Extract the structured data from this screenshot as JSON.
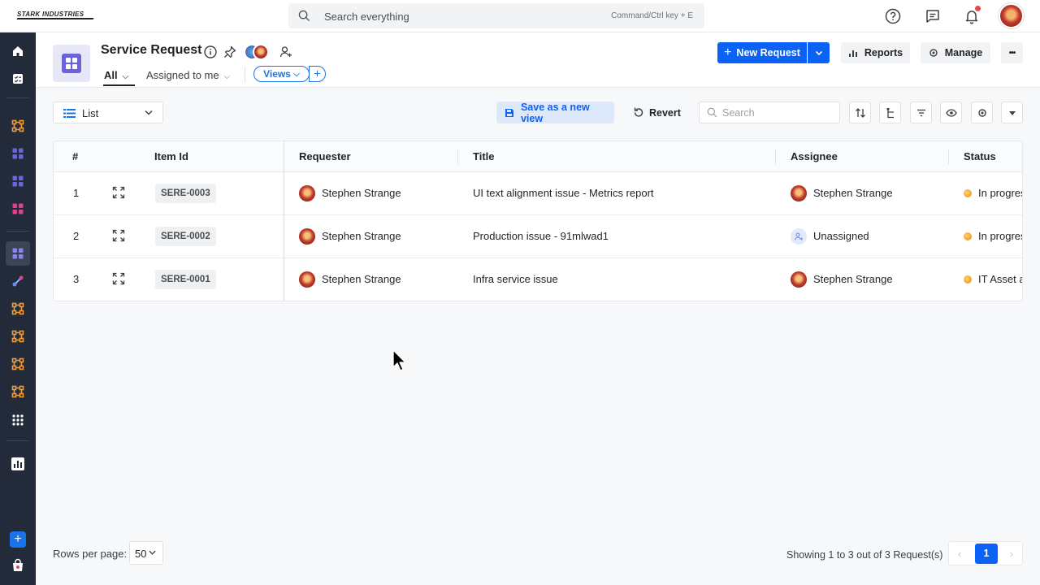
{
  "topbar": {
    "logo_text": "STARK INDUSTRIES",
    "search_placeholder": "Search everything",
    "search_shortcut": "Command/Ctrl key + E",
    "icons": [
      "help-icon",
      "feedback-icon",
      "bell-icon",
      "user-avatar"
    ]
  },
  "sidebar": {
    "items": [
      "home-icon",
      "tasks-icon",
      "workflow-icon",
      "apps-icon",
      "apps-icon",
      "apps-icon",
      "service-request-icon",
      "integration-icon",
      "workflow-icon",
      "workflow-icon",
      "workflow-icon",
      "workflow-icon",
      "all-apps-icon",
      "reports-icon"
    ],
    "add_label": "+"
  },
  "header": {
    "title": "Service Request",
    "tabs": [
      {
        "label": "All",
        "active": true
      },
      {
        "label": "Assigned to me",
        "active": false
      }
    ],
    "views_label": "Views",
    "views_add": "+",
    "new_request_label": "New Request",
    "reports_label": "Reports",
    "manage_label": "Manage",
    "more_label": "•••"
  },
  "toolbar": {
    "view_select": "List",
    "save_view_label": "Save as a new view",
    "revert_label": "Revert",
    "search_placeholder": "Search"
  },
  "table": {
    "columns": [
      "#",
      "Item Id",
      "Requester",
      "Title",
      "Assignee",
      "Status"
    ],
    "rows": [
      {
        "num": "1",
        "item_id": "SERE-0003",
        "requester": "Stephen Strange",
        "title": "UI text alignment issue - Metrics report",
        "assignee": "Stephen Strange",
        "assignee_unassigned": false,
        "status": "In progres"
      },
      {
        "num": "2",
        "item_id": "SERE-0002",
        "requester": "Stephen Strange",
        "title": "Production issue - 91mlwad1",
        "assignee": "Unassigned",
        "assignee_unassigned": true,
        "status": "In progres"
      },
      {
        "num": "3",
        "item_id": "SERE-0001",
        "requester": "Stephen Strange",
        "title": "Infra service issue",
        "assignee": "Stephen Strange",
        "assignee_unassigned": false,
        "status": "IT Asset a"
      }
    ]
  },
  "footer": {
    "rows_per_page_label": "Rows per page:",
    "rows_per_page_value": "50",
    "showing_text": "Showing 1 to 3 out of 3 Request(s)",
    "current_page": "1",
    "prev": "‹",
    "next": "›"
  },
  "colors": {
    "primary": "#0b63f6",
    "sidebar_bg": "#232b3a",
    "accent_orange": "#f29b38",
    "accent_purple": "#6c63d9",
    "accent_pink": "#e0408c"
  }
}
